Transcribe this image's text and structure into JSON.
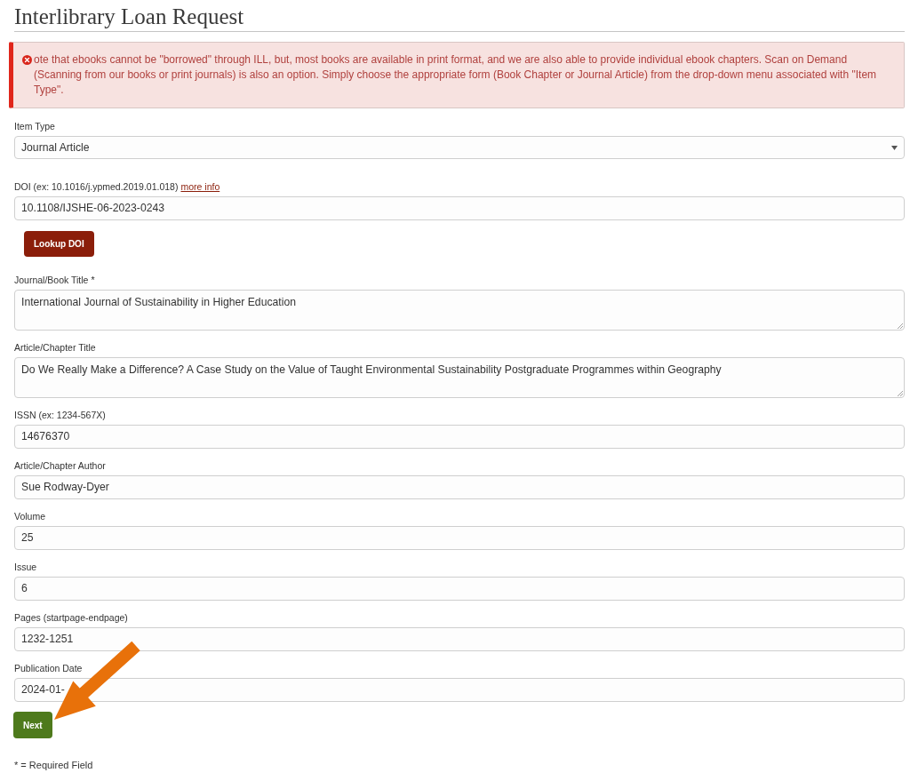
{
  "page_title": "Interlibrary Loan Request",
  "alert": {
    "kind": "error",
    "text": "ote that ebooks cannot be \"borrowed\" through ILL, but, most books are available in print format, and we are also able to provide individual ebook chapters. Scan on Demand (Scanning from our books or print journals) is also an option. Simply choose the appropriate form (Book Chapter or Journal Article) from the drop-down menu associated with \"Item Type\"."
  },
  "fields": [
    {
      "kind": "select",
      "label": "Item Type",
      "value": "Journal Article"
    },
    {
      "kind": "text",
      "label": "DOI (ex: 10.1016/j.ypmed.2019.01.018)",
      "link": "more info",
      "value": "10.1108/IJSHE-06-2023-0243",
      "button": "Lookup DOI"
    },
    {
      "kind": "textarea",
      "label": "Journal/Book Title *",
      "value": "International Journal of Sustainability in Higher Education"
    },
    {
      "kind": "textarea",
      "label": "Article/Chapter Title",
      "value": "Do We Really Make a Difference? A Case Study on the Value of Taught Environmental Sustainability Postgraduate Programmes within Geography"
    },
    {
      "kind": "text",
      "label": "ISSN (ex: 1234-567X)",
      "value": "14676370"
    },
    {
      "kind": "text",
      "label": "Article/Chapter Author",
      "value": "Sue Rodway-Dyer"
    },
    {
      "kind": "text",
      "label": "Volume",
      "value": "25"
    },
    {
      "kind": "text",
      "label": "Issue",
      "value": "6"
    },
    {
      "kind": "text",
      "label": "Pages (startpage-endpage)",
      "value": "1232-1251"
    },
    {
      "kind": "text",
      "label": "Publication Date",
      "value": "2024-01-"
    }
  ],
  "submit_button": "Next",
  "footnote": "* = Required Field",
  "annotations": [
    {
      "kind": "arrow"
    }
  ]
}
